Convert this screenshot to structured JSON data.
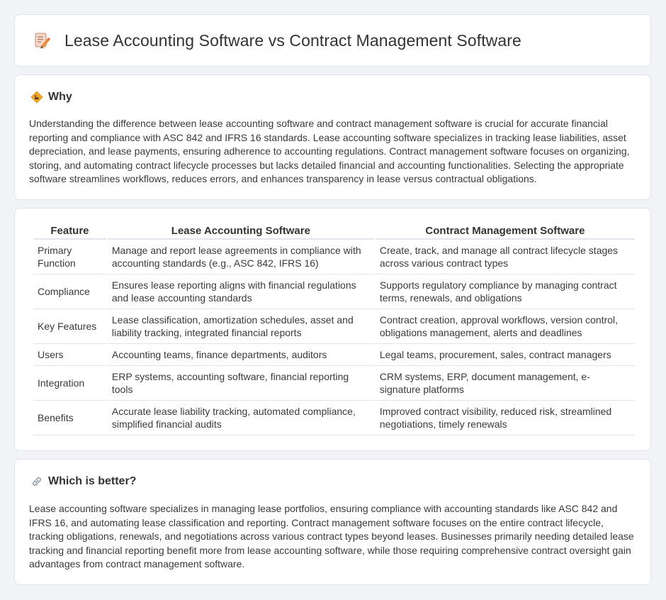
{
  "header": {
    "title": "Lease Accounting Software vs Contract Management Software",
    "icon": "edit-document-icon"
  },
  "why": {
    "title": "Why",
    "icon": "warning-sign-icon",
    "text": "Understanding the difference between lease accounting software and contract management software is crucial for accurate financial reporting and compliance with ASC 842 and IFRS 16 standards. Lease accounting software specializes in tracking lease liabilities, asset depreciation, and lease payments, ensuring adherence to accounting regulations. Contract management software focuses on organizing, storing, and automating contract lifecycle processes but lacks detailed financial and accounting functionalities. Selecting the appropriate software streamlines workflows, reduces errors, and enhances transparency in lease versus contractual obligations."
  },
  "table": {
    "headers": [
      "Feature",
      "Lease Accounting Software",
      "Contract Management Software"
    ],
    "rows": [
      [
        "Primary Function",
        "Manage and report lease agreements in compliance with accounting standards (e.g., ASC 842, IFRS 16)",
        "Create, track, and manage all contract lifecycle stages across various contract types"
      ],
      [
        "Compliance",
        "Ensures lease reporting aligns with financial regulations and lease accounting standards",
        "Supports regulatory compliance by managing contract terms, renewals, and obligations"
      ],
      [
        "Key Features",
        "Lease classification, amortization schedules, asset and liability tracking, integrated financial reports",
        "Contract creation, approval workflows, version control, obligations management, alerts and deadlines"
      ],
      [
        "Users",
        "Accounting teams, finance departments, auditors",
        "Legal teams, procurement, sales, contract managers"
      ],
      [
        "Integration",
        "ERP systems, accounting software, financial reporting tools",
        "CRM systems, ERP, document management, e-signature platforms"
      ],
      [
        "Benefits",
        "Accurate lease liability tracking, automated compliance, simplified financial audits",
        "Improved contract visibility, reduced risk, streamlined negotiations, timely renewals"
      ]
    ]
  },
  "better": {
    "title": "Which is better?",
    "icon": "link-icon",
    "text": "Lease accounting software specializes in managing lease portfolios, ensuring compliance with accounting standards like ASC 842 and IFRS 16, and automating lease classification and reporting. Contract management software focuses on the entire contract lifecycle, tracking obligations, renewals, and negotiations across various contract types beyond leases. Businesses primarily needing detailed lease tracking and financial reporting benefit more from lease accounting software, while those requiring comprehensive contract oversight gain advantages from contract management software."
  }
}
